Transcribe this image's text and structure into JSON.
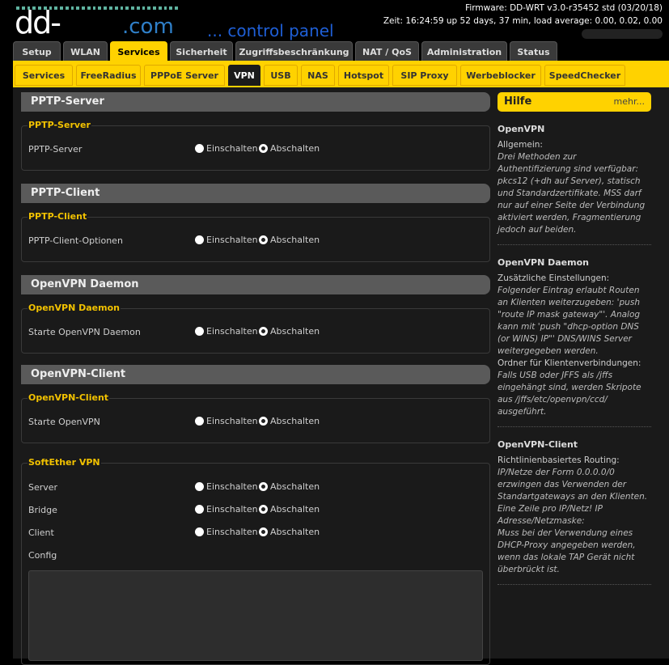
{
  "header": {
    "logo_main": "dd-wrt",
    "logo_com": ".com",
    "logo_panel": "... control panel",
    "firmware": "Firmware: DD-WRT v3.0-r35452 std (03/20/18)",
    "uptime": "Zeit: 16:24:59 up 52 days, 37 min, load average: 0.00, 0.02, 0.00"
  },
  "main_tabs": [
    {
      "label": "Setup",
      "active": false
    },
    {
      "label": "WLAN",
      "active": false
    },
    {
      "label": "Services",
      "active": true
    },
    {
      "label": "Sicherheit",
      "active": false
    },
    {
      "label": "Zugriffsbeschränkung",
      "active": false
    },
    {
      "label": "NAT / QoS",
      "active": false
    },
    {
      "label": "Administration",
      "active": false
    },
    {
      "label": "Status",
      "active": false
    }
  ],
  "sub_tabs": [
    {
      "label": "Services",
      "active": false
    },
    {
      "label": "FreeRadius",
      "active": false
    },
    {
      "label": "PPPoE Server",
      "active": false
    },
    {
      "label": "VPN",
      "active": true
    },
    {
      "label": "USB",
      "active": false
    },
    {
      "label": "NAS",
      "active": false
    },
    {
      "label": "Hotspot",
      "active": false
    },
    {
      "label": "SIP Proxy",
      "active": false
    },
    {
      "label": "Werbeblocker",
      "active": false
    },
    {
      "label": "SpeedChecker",
      "active": false
    }
  ],
  "radio": {
    "on": "Einschalten",
    "off": "Abschalten"
  },
  "sections": {
    "pptp_server": {
      "title": "PPTP-Server",
      "legend": "PPTP-Server",
      "field": "PPTP-Server",
      "value": "off"
    },
    "pptp_client": {
      "title": "PPTP-Client",
      "legend": "PPTP-Client",
      "field": "PPTP-Client-Optionen",
      "value": "off"
    },
    "openvpn_daemon": {
      "title": "OpenVPN Daemon",
      "legend": "OpenVPN Daemon",
      "field": "Starte OpenVPN Daemon",
      "value": "off"
    },
    "openvpn_client": {
      "title": "OpenVPN-Client",
      "legend": "OpenVPN-Client",
      "field": "Starte OpenVPN",
      "value": "off"
    },
    "softether": {
      "legend": "SoftEther VPN",
      "server": "Server",
      "server_value": "off",
      "bridge": "Bridge",
      "bridge_value": "off",
      "client": "Client",
      "client_value": "off",
      "config": "Config"
    }
  },
  "help": {
    "title": "Hilfe",
    "more": "mehr...",
    "openvpn": {
      "title": "OpenVPN",
      "label": "Allgemein:",
      "text": "Drei Methoden zur Authentifizierung sind verfügbar: pkcs12 (+dh auf Server), statisch und Standardzertifikate. MSS darf nur auf einer Seite der Verbindung aktiviert werden, Fragmentierung jedoch auf beiden."
    },
    "daemon": {
      "title": "OpenVPN Daemon",
      "label1": "Zusätzliche Einstellungen:",
      "text1": "Folgender Eintrag erlaubt Routen an Klienten weiterzugeben: 'push \"route IP mask gateway\"'. Analog kann mit 'push \"dhcp-option DNS (or WINS) IP\"' DNS/WINS Server weitergegeben werden.",
      "label2": "Ordner für Klientenverbindungen:",
      "text2": "Falls USB oder JFFS als /jffs eingehängt sind, werden Skripote aus /jffs/etc/openvpn/ccd/ ausgeführt."
    },
    "client": {
      "title": "OpenVPN-Client",
      "label1": "Richtlinienbasiertes Routing:",
      "text1": "IP/Netze der Form 0.0.0.0/0 erzwingen das Verwenden der Standartgateways an den Klienten. Eine Zeile pro IP/Netz! IP Adresse/Netzmaske:",
      "text2": "Muss bei der Verwendung eines DHCP-Proxy angegeben werden, wenn das lokale TAP Gerät nicht überbrückt ist."
    }
  },
  "colors": {
    "accent": "#ffd200",
    "legend": "#f2c200",
    "section": "#5a5a5a",
    "panel": "#1a1a1a"
  }
}
